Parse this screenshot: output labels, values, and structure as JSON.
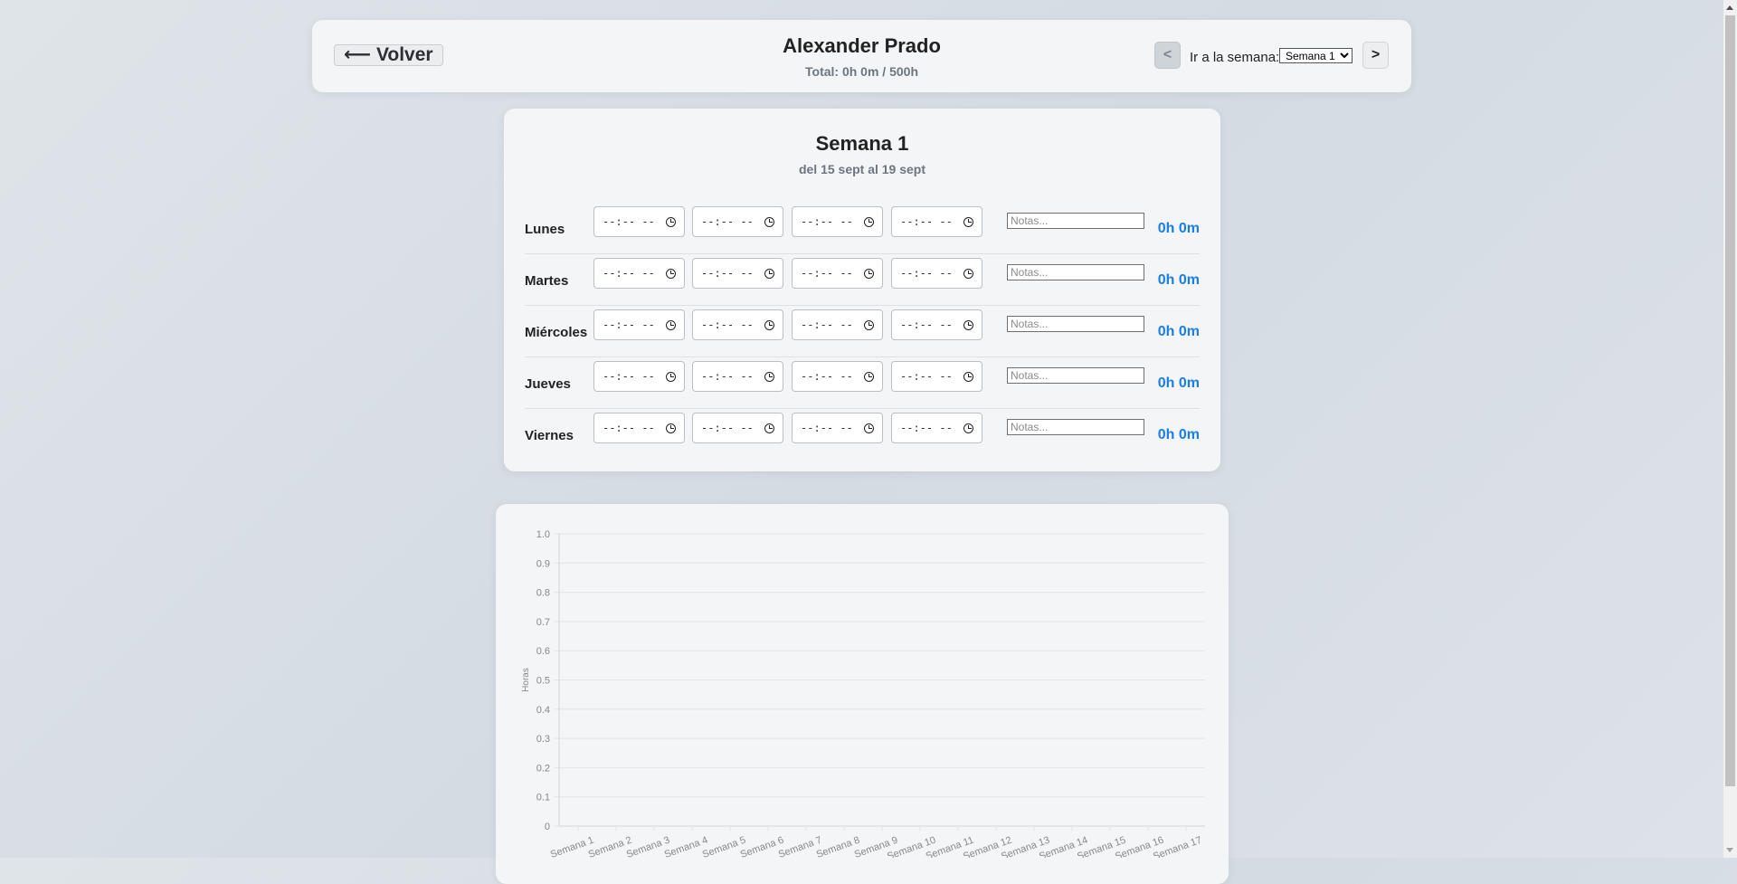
{
  "header": {
    "back_label": "⟵ Volver",
    "title": "Alexander Prado",
    "total": "Total: 0h 0m / 500h",
    "prev_label": "<",
    "nav_label": "Ir a la semana:",
    "week_select_value": "Semana 1",
    "next_label": ">"
  },
  "week": {
    "title": "Semana 1",
    "range": "del 15 sept al 19 sept",
    "time_placeholder": "--:-- --",
    "notes_placeholder": "Notas...",
    "days": [
      {
        "name": "Lunes",
        "hours": "0h 0m"
      },
      {
        "name": "Martes",
        "hours": "0h 0m"
      },
      {
        "name": "Miércoles",
        "hours": "0h 0m"
      },
      {
        "name": "Jueves",
        "hours": "0h 0m"
      },
      {
        "name": "Viernes",
        "hours": "0h 0m"
      }
    ]
  },
  "chart_data": {
    "type": "bar",
    "ylabel": "Horas",
    "ylim": [
      0,
      1.0
    ],
    "yticks": [
      "0",
      "0.1",
      "0.2",
      "0.3",
      "0.4",
      "0.5",
      "0.6",
      "0.7",
      "0.8",
      "0.9",
      "1.0"
    ],
    "categories": [
      "Semana 1",
      "Semana 2",
      "Semana 3",
      "Semana 4",
      "Semana 5",
      "Semana 6",
      "Semana 7",
      "Semana 8",
      "Semana 9",
      "Semana 10",
      "Semana 11",
      "Semana 12",
      "Semana 13",
      "Semana 14",
      "Semana 15",
      "Semana 16",
      "Semana 17"
    ],
    "values": [
      0,
      0,
      0,
      0,
      0,
      0,
      0,
      0,
      0,
      0,
      0,
      0,
      0,
      0,
      0,
      0,
      0
    ],
    "grid": true,
    "colors": {
      "grid": "#e2e5e8",
      "tick": "#888888"
    }
  }
}
